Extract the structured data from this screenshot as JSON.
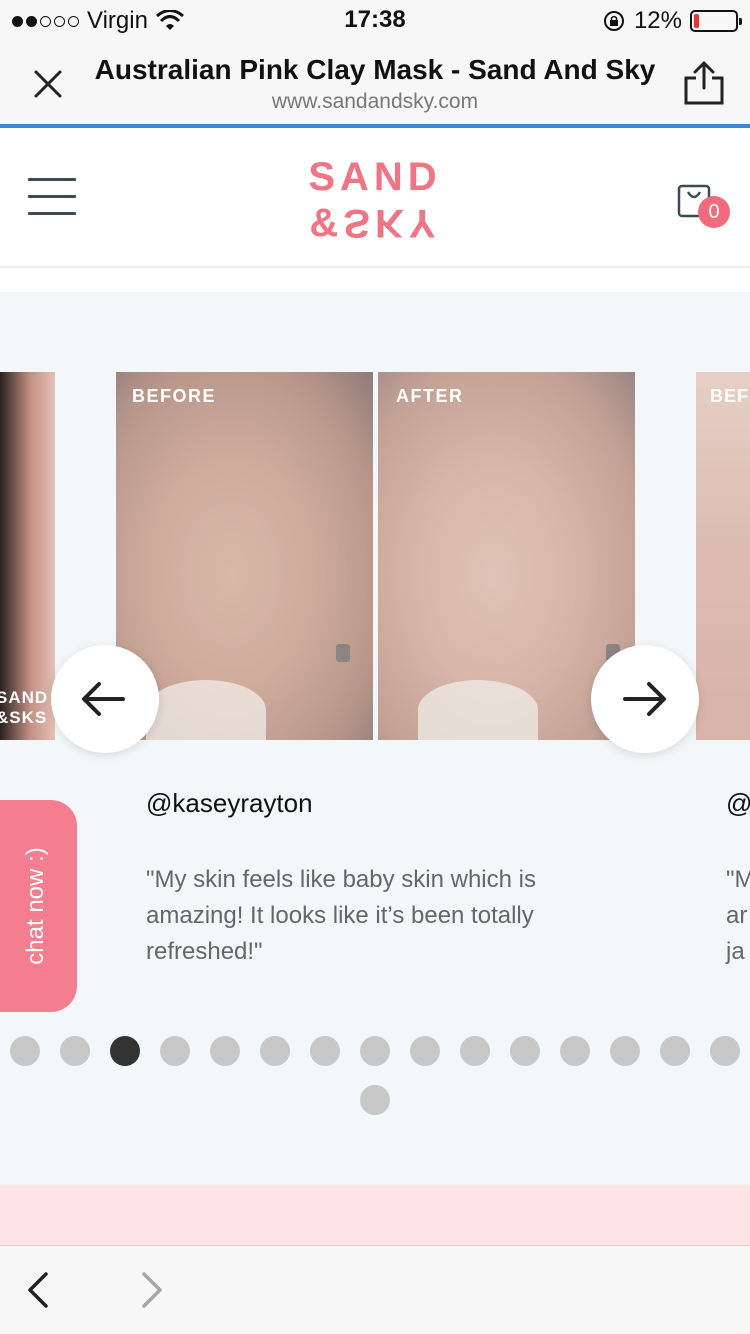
{
  "status_bar": {
    "carrier": "Virgin",
    "time": "17:38",
    "battery_percent": "12%",
    "battery_level": 0.12,
    "signal_bars": 2,
    "icons": [
      "wifi-icon",
      "rotation-lock-icon",
      "battery-icon"
    ]
  },
  "browser": {
    "page_title": "Australian Pink Clay Mask - Sand And Sky",
    "url": "www.sandandsky.com",
    "progress_color": "#3b88d6"
  },
  "site_header": {
    "logo_line1": "SAND",
    "logo_line2_prefix": "&",
    "logo_line2_flipped": "SKY",
    "logo_color": "#f07584",
    "cart_count": "0"
  },
  "testimonial": {
    "before_label": "BEFORE",
    "after_label": "AFTER",
    "username": "@kaseyrayton",
    "quote": "\"My skin feels like baby skin which is amazing! It looks like it’s been totally refreshed!\"",
    "left_peek_brand_line1": "SAND",
    "left_peek_brand_line2": "&SKS",
    "right_peek_label": "BEFO",
    "right_peek_username": "@",
    "right_peek_quote": "\"M\nar\nja",
    "corner_brand_line1": "SA",
    "corner_brand_line2": "&"
  },
  "chat": {
    "label": "chat now :)"
  },
  "pagination": {
    "total": 16,
    "active_index": 2
  },
  "colors": {
    "accent_pink": "#f46a7d",
    "carousel_bg": "#f4f7f9",
    "dot_inactive": "#c7c7c7",
    "dot_active": "#333333"
  }
}
